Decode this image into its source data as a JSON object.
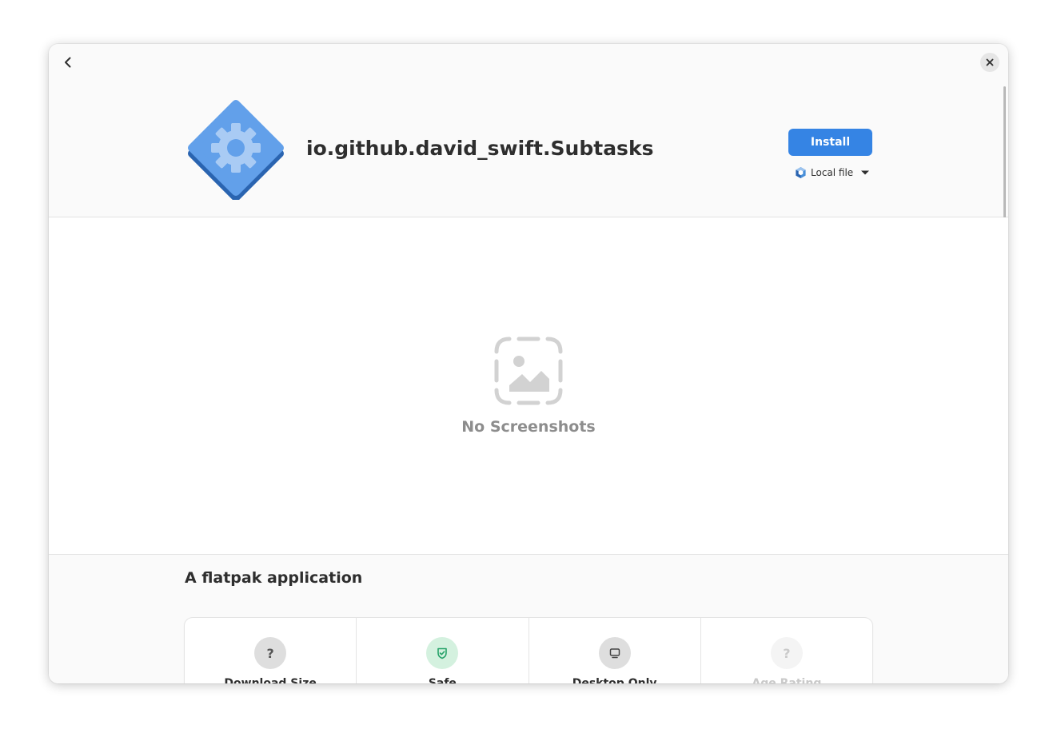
{
  "header": {
    "app_name": "io.github.david_swift.Subtasks",
    "install_label": "Install",
    "source_label": "Local file",
    "icons": {
      "back": "go-back-icon",
      "close": "close-icon",
      "app": "generic-app-gear-icon",
      "source": "flatpak-icon",
      "dropdown": "dropdown-arrow-icon"
    }
  },
  "screenshots": {
    "empty_label": "No Screenshots",
    "icon": "image-missing-icon"
  },
  "details": {
    "summary": "A flatpak application",
    "tiles": [
      {
        "label": "Download Size",
        "badge": "?",
        "icon": "question-icon",
        "state": "unknown"
      },
      {
        "label": "Safe",
        "badge": "",
        "icon": "shield-check-icon",
        "state": "safe"
      },
      {
        "label": "Desktop Only",
        "badge": "",
        "icon": "desktop-icon",
        "state": "info"
      },
      {
        "label": "Age Rating",
        "badge": "?",
        "icon": "question-icon",
        "state": "disabled"
      }
    ]
  },
  "colors": {
    "accent": "#3584e4",
    "safe": "#26a269",
    "safe_bg": "#d4f1df",
    "app_icon": "#62a0ea"
  }
}
